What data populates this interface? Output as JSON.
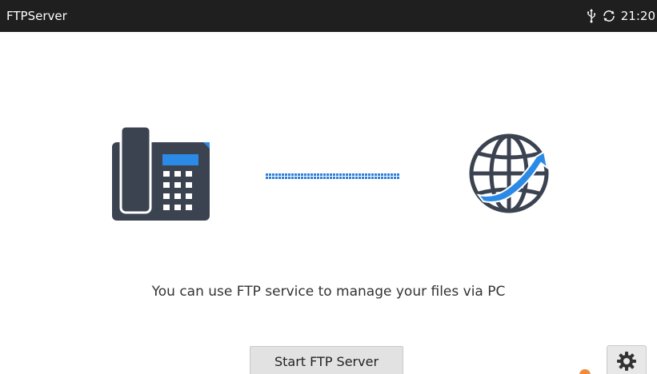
{
  "status_bar": {
    "app_title": "FTPServer",
    "time": "21:20",
    "icons": [
      "usb-icon",
      "sync-icon"
    ]
  },
  "hero": {
    "left_device_icon": "desk-phone-icon",
    "connector_icon": "dotted-link",
    "right_device_icon": "globe-transfer-icon"
  },
  "main": {
    "description": "You can use FTP service to manage your files via PC",
    "start_button_label": "Start FTP Server",
    "settings_icon": "gear-icon"
  },
  "colors": {
    "status_bar_bg": "#1f1f1f",
    "phone_body": "#3b4250",
    "accent_blue": "#2b8ae6",
    "connector_blue": "#2f7fd9",
    "button_bg": "#e2e2e2",
    "badge_orange": "#f08a3c"
  }
}
